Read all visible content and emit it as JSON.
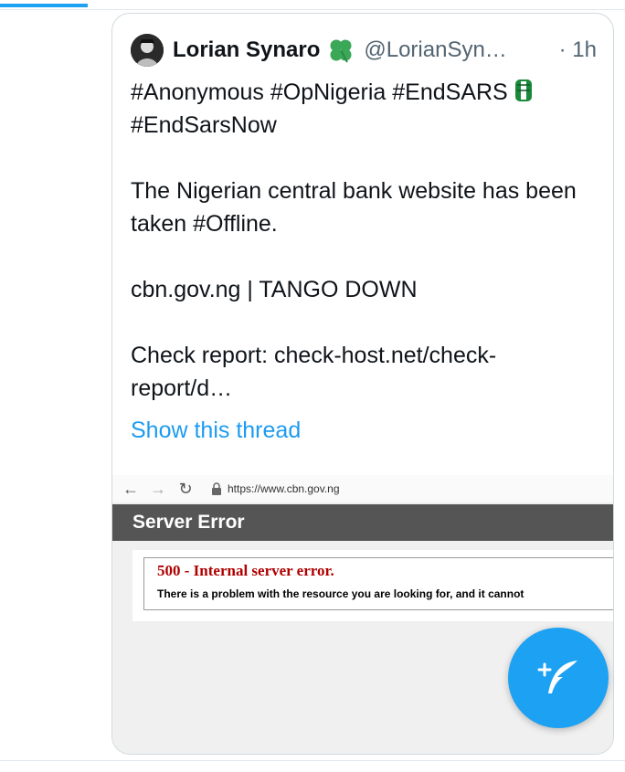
{
  "tweet": {
    "display_name": "Lorian Synaro",
    "handle": "@LorianSyn…",
    "time": "· 1h",
    "line1": "#Anonymous #OpNigeria #EndSARS",
    "line2": "#EndSarsNow",
    "para2": "The Nigerian central bank website has been taken #Offline.",
    "para3": "cbn.gov.ng | TANGO DOWN",
    "para4": "Check report: check-host.net/check-report/d…",
    "show_thread": "Show this thread"
  },
  "media": {
    "url": "https://www.cbn.gov.ng",
    "banner_title": "Server Error",
    "error_code": "500 - Internal server error.",
    "error_message": "There is a problem with the resource you are looking for, and it cannot"
  },
  "icons": {
    "clover": "four-leaf-clover-icon",
    "fist": "raised-fist-icon",
    "compose": "compose-feather-icon"
  },
  "colors": {
    "accent": "#1da1f2",
    "link": "#1d9bf0",
    "error_red": "#b00000",
    "banner": "#555555"
  }
}
